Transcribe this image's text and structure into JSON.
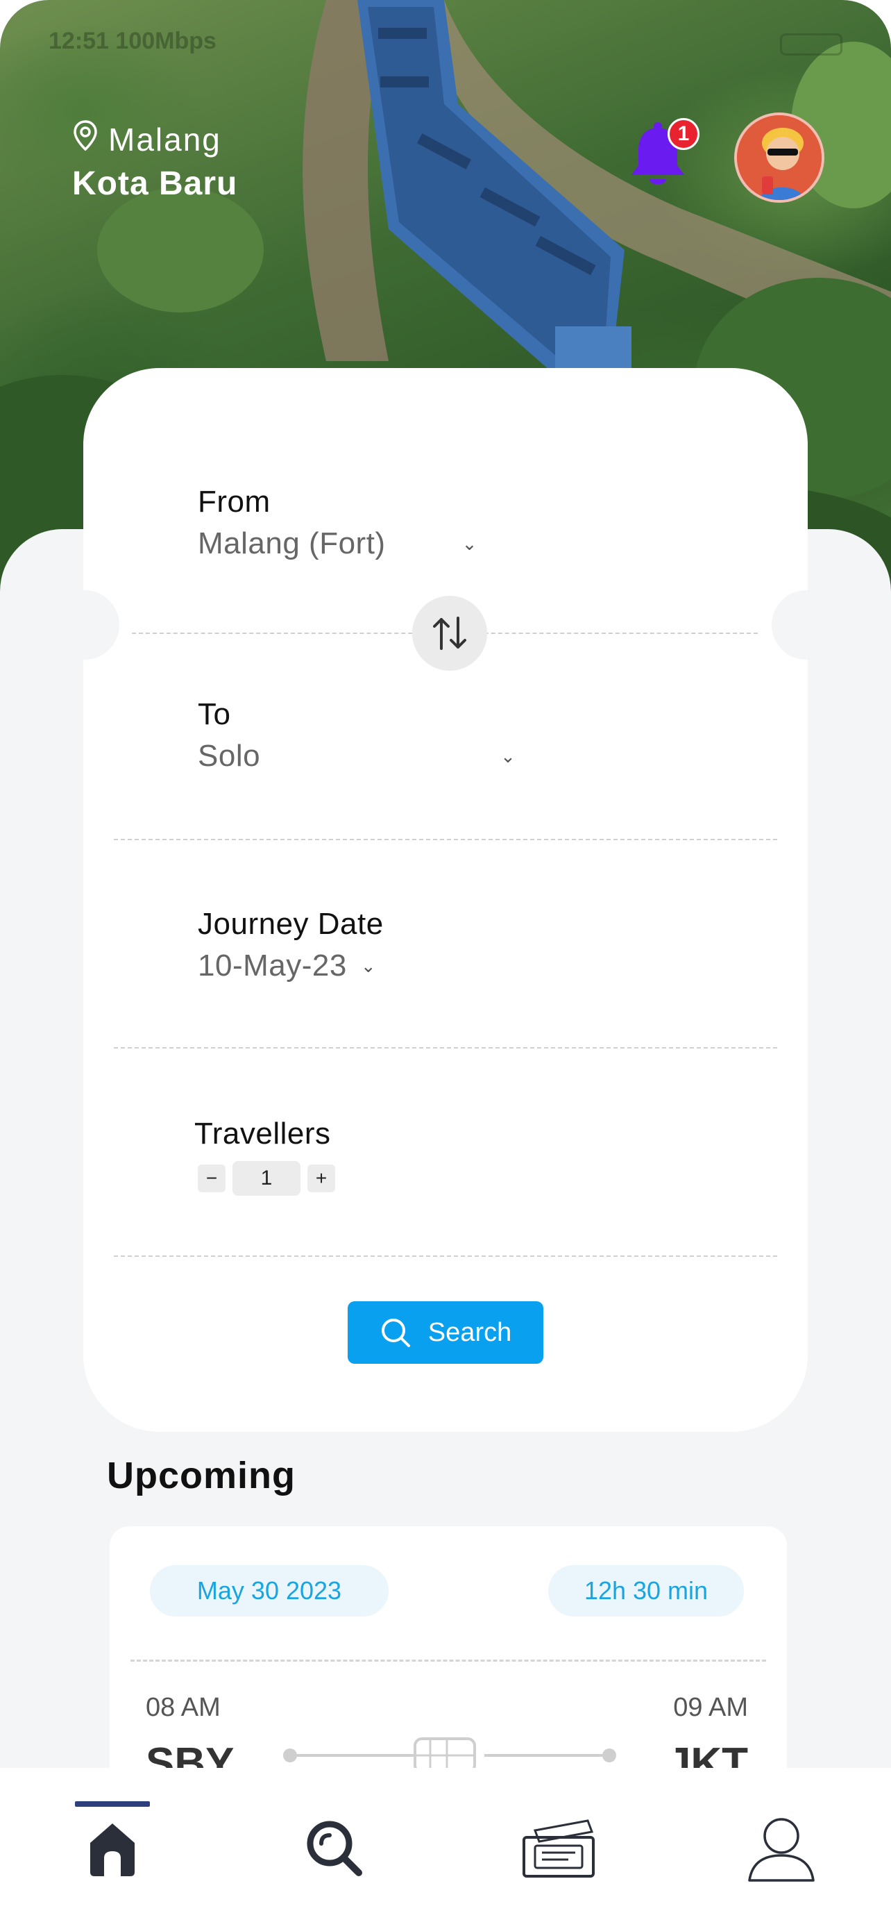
{
  "status_bar": {
    "time": "12:51 100Mbps"
  },
  "header": {
    "location_city": "Malang",
    "location_area": "Kota Baru",
    "notification_count": "1",
    "colors": {
      "bell": "#6a1cf0",
      "badge": "#e8232f"
    }
  },
  "booking": {
    "from_label": "From",
    "from_value": "Malang (Fort)",
    "to_label": "To",
    "to_value": "Solo",
    "date_label": "Journey Date",
    "date_value": "10-May-23",
    "travellers_label": "Travellers",
    "travellers_minus": "−",
    "travellers_value": "1",
    "travellers_plus": "+",
    "search_label": "Search",
    "colors": {
      "accent": "#0aa0f0"
    }
  },
  "upcoming": {
    "title": "Upcoming",
    "trip": {
      "date": "May 30 2023",
      "duration": "12h 30 min",
      "depart_time": "08 AM",
      "arrive_time": "09 AM",
      "depart_code": "SBY",
      "arrive_code": "JKT"
    }
  },
  "nav": {
    "items": [
      "home-icon",
      "search-icon",
      "ticket-icon",
      "profile-icon"
    ],
    "active": "home",
    "colors": {
      "indicator": "#2d3f7c"
    }
  }
}
